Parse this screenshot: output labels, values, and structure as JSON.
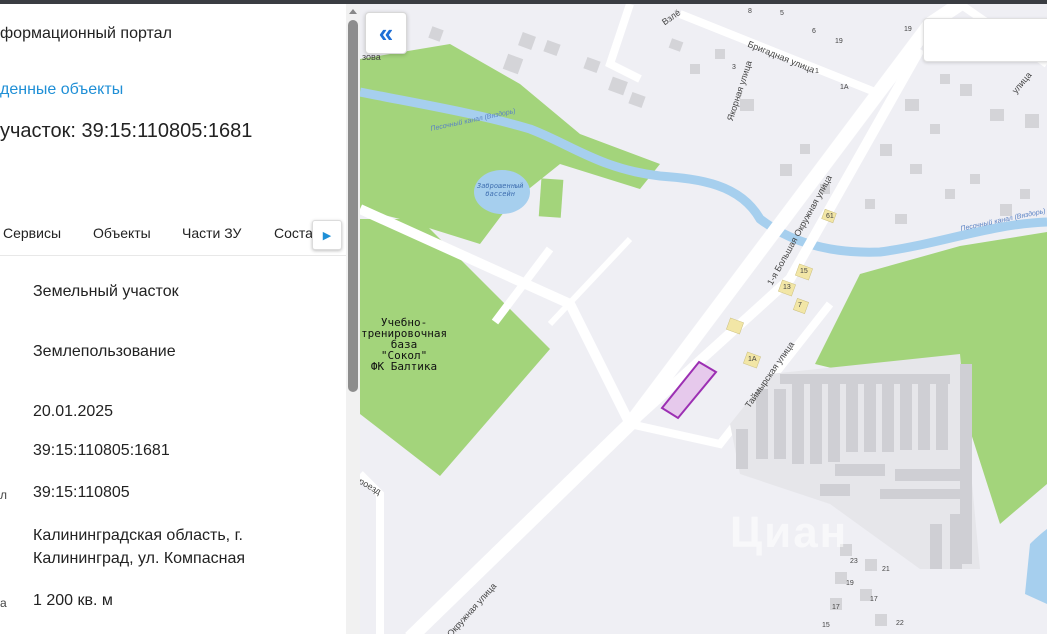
{
  "header": {
    "portal_title": "формационный портал",
    "found_link": "денные объекты",
    "parcel_title": "участок: 39:15:110805:1681"
  },
  "tabs": [
    {
      "label": "Сервисы"
    },
    {
      "label": "Объекты"
    },
    {
      "label": "Части ЗУ"
    },
    {
      "label": "Соста"
    }
  ],
  "tab_scroll_icon": "caret-right-icon",
  "details": [
    {
      "label": "",
      "value": "Земельный участок"
    },
    {
      "label": "",
      "value": "Землепользование"
    },
    {
      "label": "",
      "value": "20.01.2025"
    },
    {
      "label": "",
      "value": "39:15:110805:1681"
    },
    {
      "label": "л",
      "value": "39:15:110805"
    },
    {
      "label": "",
      "value_lines": [
        "Калининградская область, г.",
        "Калининград, ул. Компасная"
      ]
    },
    {
      "label": "а",
      "value": "1 200 кв. м"
    }
  ],
  "map": {
    "collapse_icon": "double-chevron-left-icon",
    "search_placeholder": "",
    "poi_label": "Учебно-\nтренировочная\nбаза\n\"Сокол\"\nФК Балтика",
    "pond_label": "Заброшенный\nбассейн",
    "streets": {
      "brigadnaya": "Бригадная улица",
      "yakornaya": "Якорная улица",
      "bolshaya_okruzhnaya_1": "1-я Большая Окружная улица",
      "taymyrskaya": "Таймырская улица",
      "okruzhnaya": "Окружная улица",
      "vzlet": "Взлё",
      "zova": "зова",
      "proezd": "роезд",
      "ulitsa_right": "улица"
    },
    "canal_label": "Песочный канал (Вяздорь)",
    "house_numbers": [
      "8",
      "5",
      "6",
      "19",
      "1",
      "1А",
      "3",
      "15",
      "13",
      "7",
      "1А",
      "61",
      "23",
      "21",
      "19",
      "17",
      "17",
      "15",
      "22",
      "19"
    ],
    "watermark": "Циан",
    "colors": {
      "background": "#efeff4",
      "green": "#a3d47b",
      "water": "#a6cfee",
      "road": "#ffffff",
      "building": "#d4d4d8",
      "parcel_fill": "#e6c9ec",
      "parcel_stroke": "#9c2fb3",
      "accent": "#1f8fd6"
    }
  }
}
